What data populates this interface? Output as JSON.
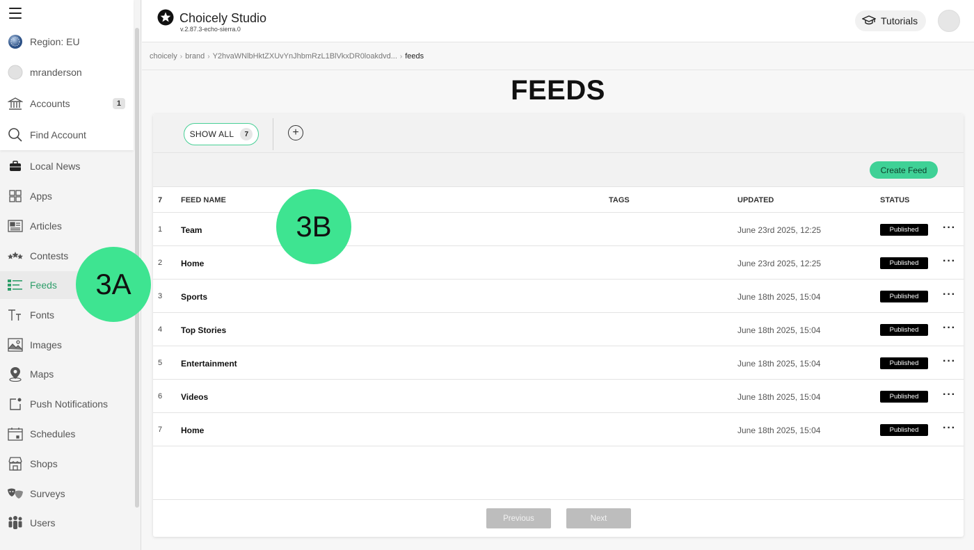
{
  "sidebar": {
    "top_items": [
      {
        "label": "Region: EU",
        "icon": "globe-icon"
      },
      {
        "label": "mranderson",
        "icon": "avatar-icon"
      },
      {
        "label": "Accounts",
        "icon": "bank-icon",
        "count": "1"
      },
      {
        "label": "Find Account",
        "icon": "search-icon"
      }
    ],
    "items": [
      {
        "label": "Local News",
        "icon": "briefcase-icon"
      },
      {
        "label": "Apps",
        "icon": "grid-icon"
      },
      {
        "label": "Articles",
        "icon": "article-icon"
      },
      {
        "label": "Contests",
        "icon": "stars-icon"
      },
      {
        "label": "Feeds",
        "icon": "feed-list-icon",
        "active": true
      },
      {
        "label": "Fonts",
        "icon": "font-icon"
      },
      {
        "label": "Images",
        "icon": "image-icon"
      },
      {
        "label": "Maps",
        "icon": "map-pin-icon"
      },
      {
        "label": "Push Notifications",
        "icon": "notification-icon"
      },
      {
        "label": "Schedules",
        "icon": "calendar-icon"
      },
      {
        "label": "Shops",
        "icon": "shop-icon"
      },
      {
        "label": "Surveys",
        "icon": "masks-icon"
      },
      {
        "label": "Users",
        "icon": "users-icon"
      }
    ]
  },
  "header": {
    "title": "Choicely Studio",
    "version": "v.2.87.3-echo-sierra.0",
    "tutorials_label": "Tutorials"
  },
  "breadcrumb": [
    "choicely",
    "brand",
    "Y2hvaWNlbHktZXUvYnJhbmRzL1BlVkxDR0loakdvd...",
    "feeds"
  ],
  "page_title": "FEEDS",
  "tabs": {
    "show_all_label": "SHOW ALL",
    "show_all_count": "7",
    "add_label": "+"
  },
  "actions": {
    "create_label": "Create Feed"
  },
  "table": {
    "count": "7",
    "columns": {
      "name": "FEED NAME",
      "tags": "TAGS",
      "updated": "UPDATED",
      "status": "STATUS"
    },
    "rows": [
      {
        "num": "1",
        "name": "Team",
        "updated": "June 23rd 2025, 12:25",
        "status": "Published"
      },
      {
        "num": "2",
        "name": "Home",
        "updated": "June 23rd 2025, 12:25",
        "status": "Published"
      },
      {
        "num": "3",
        "name": "Sports",
        "updated": "June 18th 2025, 15:04",
        "status": "Published"
      },
      {
        "num": "4",
        "name": "Top Stories",
        "updated": "June 18th 2025, 15:04",
        "status": "Published"
      },
      {
        "num": "5",
        "name": "Entertainment",
        "updated": "June 18th 2025, 15:04",
        "status": "Published"
      },
      {
        "num": "6",
        "name": "Videos",
        "updated": "June 18th 2025, 15:04",
        "status": "Published"
      },
      {
        "num": "7",
        "name": "Home",
        "updated": "June 18th 2025, 15:04",
        "status": "Published"
      }
    ]
  },
  "pagination": {
    "previous": "Previous",
    "next": "Next"
  },
  "annotations": {
    "a": "3A",
    "b": "3B"
  },
  "colors": {
    "accent": "#3fd196",
    "active_text": "#2e9e6a",
    "status_badge": "#000000"
  }
}
